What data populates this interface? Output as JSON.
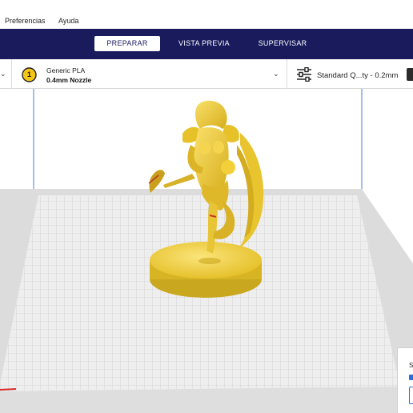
{
  "menu": {
    "items": [
      "Preferencias",
      "Ayuda"
    ]
  },
  "stages": {
    "tabs": [
      "PREPARAR",
      "VISTA PREVIA",
      "SUPERVISAR"
    ],
    "active": "PREPARAR"
  },
  "toolbar": {
    "extruder_number": "1",
    "material": "Generic PLA",
    "nozzle": "0.4mm Nozzle",
    "profile": "Standard Q...ty - 0.2mm"
  },
  "side_panel": {
    "label": "S"
  },
  "colors": {
    "header_bg": "#191b5d",
    "model": "#f2d13a",
    "model_shade": "#c9a820",
    "build_plate": "#d6d6d6",
    "axis_x": "#d92b2b",
    "axis_y": "#2a6ed8",
    "extruder_badge": "#f5c518"
  },
  "icons": {
    "settings": "sliders-icon",
    "extruder": "extruder-badge-icon"
  }
}
